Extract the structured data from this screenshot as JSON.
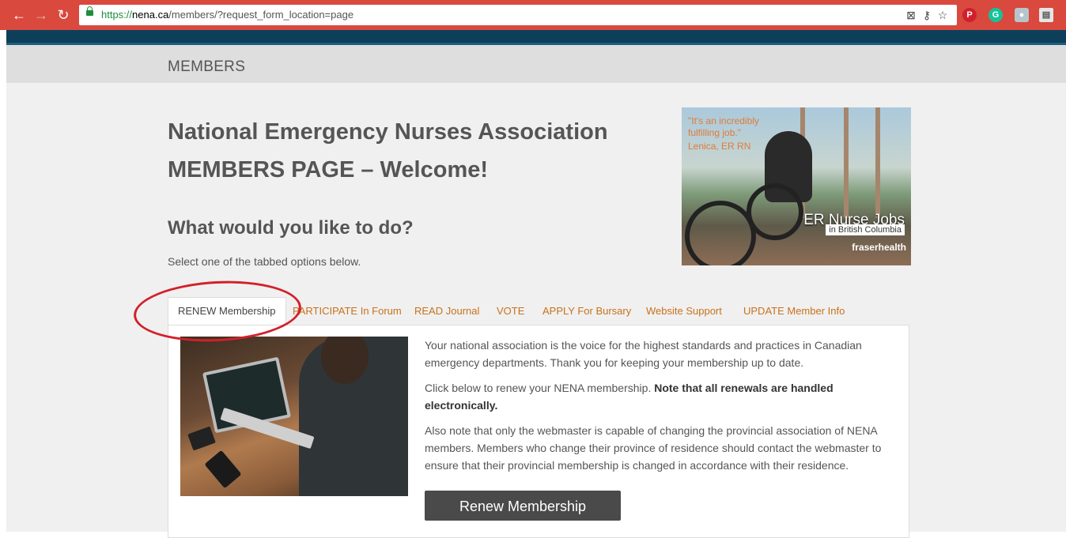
{
  "browser": {
    "url_scheme": "https://",
    "url_host": "nena.ca",
    "url_path": "/members/?request_form_location=page",
    "accent_color": "#d9493e"
  },
  "page": {
    "title_bar": "MEMBERS",
    "heading": "National Emergency Nurses Association MEMBERS PAGE – Welcome!",
    "subheading": "What would you like to do?",
    "instruction": "Select one of the tabbed options below."
  },
  "ad": {
    "quote": "\"It's an incredibly fulfilling job.\"",
    "attribution": "Lenica, ER RN",
    "headline": "ER Nurse Jobs",
    "subline": "in British Columbia",
    "brand": "fraserhealth"
  },
  "tabs": [
    {
      "label": "RENEW Membership",
      "active": true
    },
    {
      "label": "PARTICIPATE In Forum",
      "active": false
    },
    {
      "label": "READ Journal",
      "active": false
    },
    {
      "label": "VOTE",
      "active": false
    },
    {
      "label": "APPLY For Bursary",
      "active": false
    },
    {
      "label": "Website Support",
      "active": false
    },
    {
      "label": "UPDATE Member Info",
      "active": false
    }
  ],
  "panel": {
    "p1": "Your national association is the voice for the highest standards and practices in Canadian emergency departments. Thank you for keeping your membership up to date.",
    "p2_plain": "Click below to renew your NENA membership. ",
    "p2_bold": "Note that all renewals are handled electronically.",
    "p3": "Also note that only the webmaster is capable of changing the provincial association of NENA members. Members who change their province of residence should contact the webmaster to ensure that their provincial membership is changed in accordance with their residence.",
    "button_label": "Renew Membership"
  },
  "colors": {
    "tab_link": "#c8721a",
    "annotation": "#d3202a",
    "header_band": "#0d3f5a"
  }
}
